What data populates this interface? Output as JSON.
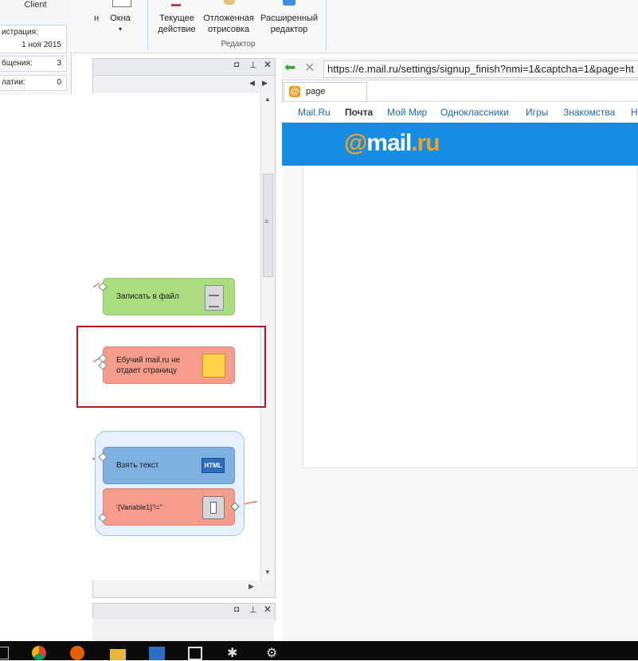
{
  "left_panel": {
    "client_label": "Client",
    "rows": [
      {
        "label": "истрация:",
        "value": "1 ноя 2015"
      },
      {
        "label": "бщения:",
        "value": "3"
      },
      {
        "label": "латии:",
        "value": "0"
      }
    ]
  },
  "ribbon": {
    "windows_label": "Окна",
    "cut_label": "н",
    "current_action": [
      "Текущее",
      "действие"
    ],
    "deferred_render": [
      "Отложенная",
      "отрисовка"
    ],
    "advanced_editor": [
      "Расширенный",
      "редактор"
    ],
    "group_label": "Редактор"
  },
  "workflow": {
    "nodes": {
      "write_file": "Записать в файл",
      "error_note": "Ебучий mail.ru не отдает страницу",
      "get_text": "Взять текст",
      "condition": "'{Variable1}'!=''",
      "html_badge": "HTML"
    }
  },
  "browser": {
    "url": "https://e.mail.ru/settings/signup_finish?nmi=1&captcha=1&page=ht",
    "tab_title": "page",
    "nav_links": [
      "Mail.Ru",
      "Почта",
      "Мой Мир",
      "Одноклассники",
      "Игры",
      "Знакомства",
      "Н"
    ],
    "logo_at": "@",
    "logo_text": "mail",
    "logo_dot": ".ru",
    "header_color": "#168de2"
  }
}
